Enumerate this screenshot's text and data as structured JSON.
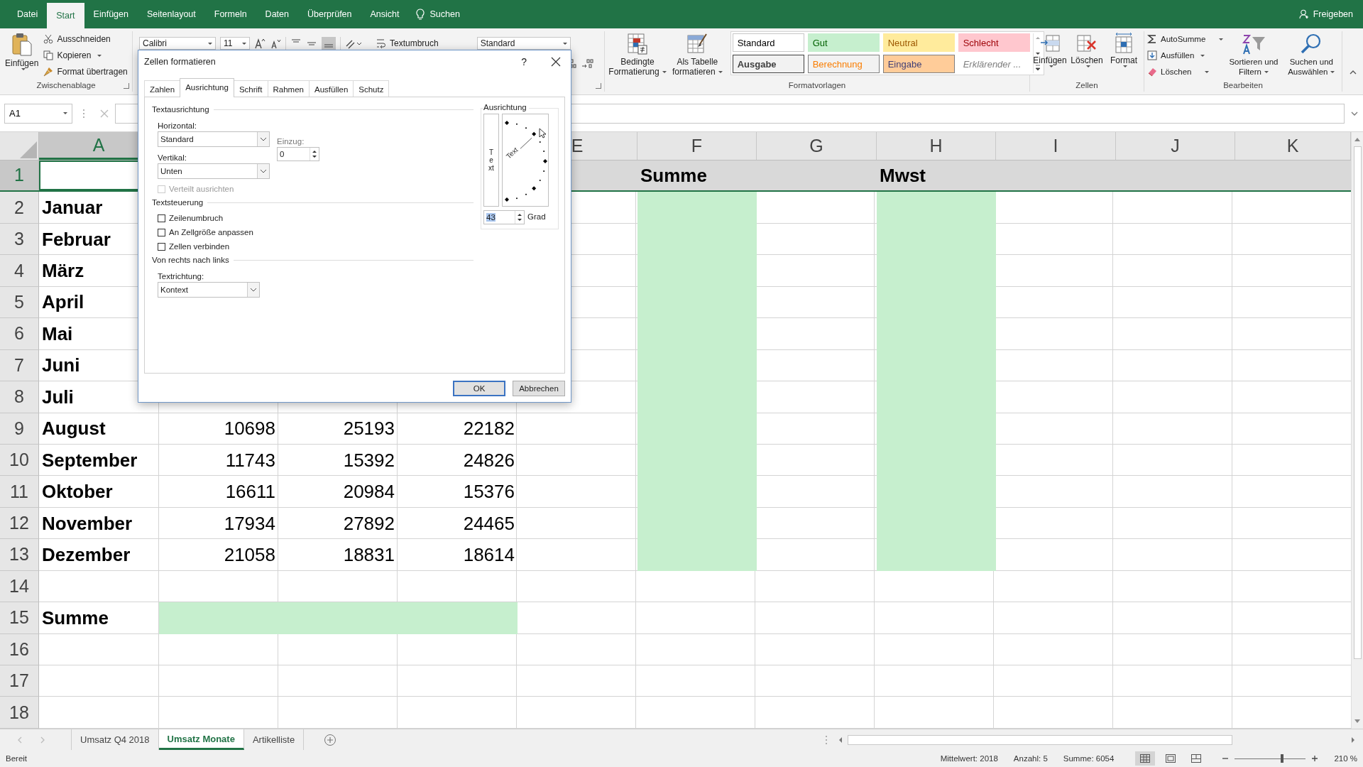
{
  "tabs": [
    {
      "label": "Datei",
      "selected": false
    },
    {
      "label": "Start",
      "selected": true
    },
    {
      "label": "Einfügen",
      "selected": false
    },
    {
      "label": "Seitenlayout",
      "selected": false
    },
    {
      "label": "Formeln",
      "selected": false
    },
    {
      "label": "Daten",
      "selected": false
    },
    {
      "label": "Überprüfen",
      "selected": false
    },
    {
      "label": "Ansicht",
      "selected": false
    }
  ],
  "search": {
    "placeholder": "Suchen"
  },
  "share": "Freigeben",
  "clipboard": {
    "paste": "Einfügen",
    "cut": "Ausschneiden",
    "copy": "Kopieren",
    "painter": "Format übertragen",
    "group": "Zwischenablage"
  },
  "font": {
    "family": "Calibri",
    "size": "11"
  },
  "wrap_text": "Textumbruch",
  "number_format": "Standard",
  "conditional_formatting": {
    "lines": [
      "Bedingte",
      "Formatierung"
    ]
  },
  "format_as_table": {
    "lines": [
      "Als Tabelle",
      "formatieren"
    ]
  },
  "styles": {
    "group": "Formatvorlagen",
    "items": [
      {
        "label": "Standard",
        "kind": "standard"
      },
      {
        "label": "Gut",
        "kind": "good"
      },
      {
        "label": "Neutral",
        "kind": "neutral"
      },
      {
        "label": "Schlecht",
        "kind": "bad"
      },
      {
        "label": "Ausgabe",
        "kind": "output"
      },
      {
        "label": "Berechnung",
        "kind": "calculation"
      },
      {
        "label": "Eingabe",
        "kind": "input"
      },
      {
        "label": "Erklärender ...",
        "kind": "explanatory"
      }
    ]
  },
  "cells_group": {
    "group": "Zellen",
    "buttons": [
      {
        "label": "Einfügen",
        "kind": "insert"
      },
      {
        "label": "Löschen",
        "kind": "delete"
      },
      {
        "label": "Format",
        "kind": "format"
      }
    ]
  },
  "editing": {
    "group": "Bearbeiten",
    "small": [
      {
        "label": "AutoSumme",
        "kind": "sum"
      },
      {
        "label": "Ausfüllen",
        "kind": "fill"
      },
      {
        "label": "Löschen",
        "kind": "clear"
      }
    ],
    "large": [
      {
        "lines": [
          "Sortieren und",
          "Filtern"
        ],
        "kind": "sort"
      },
      {
        "lines": [
          "Suchen und",
          "Auswählen"
        ],
        "kind": "find"
      }
    ]
  },
  "name_box": "A1",
  "columns": [
    {
      "label": "A",
      "selected": true
    },
    {},
    {},
    {},
    {
      "label": "E",
      "selected": false
    },
    {
      "label": "F",
      "selected": false
    },
    {
      "label": "G",
      "selected": false
    },
    {
      "label": "H",
      "selected": false
    },
    {
      "label": "I",
      "selected": false
    },
    {
      "label": "J",
      "selected": false
    },
    {
      "label": "K",
      "selected": false
    }
  ],
  "rows": [
    {
      "number": "1",
      "selected": true,
      "shaded": true,
      "cells": [
        {},
        {},
        {},
        {},
        {},
        {
          "text": "Summe",
          "kind": "label"
        },
        {},
        {
          "text": "Mwst",
          "kind": "label"
        },
        {},
        {},
        {}
      ]
    },
    {
      "number": "2",
      "selected": false,
      "shaded": false,
      "cells": [
        {
          "text": "Januar",
          "kind": "label"
        },
        {},
        {},
        {},
        {},
        {
          "highlighted": true
        },
        {},
        {
          "highlighted": true
        },
        {},
        {},
        {}
      ]
    },
    {
      "number": "3",
      "selected": false,
      "shaded": false,
      "cells": [
        {
          "text": "Februar",
          "kind": "label"
        },
        {},
        {},
        {},
        {},
        {
          "highlighted": true
        },
        {},
        {
          "highlighted": true
        },
        {},
        {},
        {}
      ]
    },
    {
      "number": "4",
      "selected": false,
      "shaded": false,
      "cells": [
        {
          "text": "März",
          "kind": "label"
        },
        {},
        {},
        {},
        {},
        {
          "highlighted": true
        },
        {},
        {
          "highlighted": true
        },
        {},
        {},
        {}
      ]
    },
    {
      "number": "5",
      "selected": false,
      "shaded": false,
      "cells": [
        {
          "text": "April",
          "kind": "label"
        },
        {},
        {},
        {},
        {},
        {
          "highlighted": true
        },
        {},
        {
          "highlighted": true
        },
        {},
        {},
        {}
      ]
    },
    {
      "number": "6",
      "selected": false,
      "shaded": false,
      "cells": [
        {
          "text": "Mai",
          "kind": "label"
        },
        {},
        {},
        {},
        {},
        {
          "highlighted": true
        },
        {},
        {
          "highlighted": true
        },
        {},
        {},
        {}
      ]
    },
    {
      "number": "7",
      "selected": false,
      "shaded": false,
      "cells": [
        {
          "text": "Juni",
          "kind": "label"
        },
        {},
        {},
        {},
        {},
        {
          "highlighted": true
        },
        {},
        {
          "highlighted": true
        },
        {},
        {},
        {}
      ]
    },
    {
      "number": "8",
      "selected": false,
      "shaded": false,
      "cells": [
        {
          "text": "Juli",
          "kind": "label"
        },
        {},
        {},
        {},
        {},
        {
          "highlighted": true
        },
        {},
        {
          "highlighted": true
        },
        {},
        {},
        {}
      ]
    },
    {
      "number": "9",
      "selected": false,
      "shaded": false,
      "cells": [
        {
          "text": "August",
          "kind": "label"
        },
        {
          "text": "10698",
          "kind": "number"
        },
        {
          "text": "25193",
          "kind": "number"
        },
        {
          "text": "22182",
          "kind": "number"
        },
        {},
        {
          "highlighted": true
        },
        {},
        {
          "highlighted": true
        },
        {},
        {},
        {}
      ]
    },
    {
      "number": "10",
      "selected": false,
      "shaded": false,
      "cells": [
        {
          "text": "September",
          "kind": "label"
        },
        {
          "text": "11743",
          "kind": "number"
        },
        {
          "text": "15392",
          "kind": "number"
        },
        {
          "text": "24826",
          "kind": "number"
        },
        {},
        {
          "highlighted": true
        },
        {},
        {
          "highlighted": true
        },
        {},
        {},
        {}
      ]
    },
    {
      "number": "11",
      "selected": false,
      "shaded": false,
      "cells": [
        {
          "text": "Oktober",
          "kind": "label"
        },
        {
          "text": "16611",
          "kind": "number"
        },
        {
          "text": "20984",
          "kind": "number"
        },
        {
          "text": "15376",
          "kind": "number"
        },
        {},
        {
          "highlighted": true
        },
        {},
        {
          "highlighted": true
        },
        {},
        {},
        {}
      ]
    },
    {
      "number": "12",
      "selected": false,
      "shaded": false,
      "cells": [
        {
          "text": "November",
          "kind": "label"
        },
        {
          "text": "17934",
          "kind": "number"
        },
        {
          "text": "27892",
          "kind": "number"
        },
        {
          "text": "24465",
          "kind": "number"
        },
        {},
        {
          "highlighted": true
        },
        {},
        {
          "highlighted": true
        },
        {},
        {},
        {}
      ]
    },
    {
      "number": "13",
      "selected": false,
      "shaded": false,
      "cells": [
        {
          "text": "Dezember",
          "kind": "label"
        },
        {
          "text": "21058",
          "kind": "number"
        },
        {
          "text": "18831",
          "kind": "number"
        },
        {
          "text": "18614",
          "kind": "number"
        },
        {},
        {
          "highlighted": true
        },
        {},
        {
          "highlighted": true
        },
        {},
        {},
        {}
      ]
    },
    {
      "number": "14",
      "selected": false,
      "shaded": false,
      "cells": [
        {},
        {},
        {},
        {},
        {},
        {},
        {},
        {},
        {},
        {},
        {}
      ]
    },
    {
      "number": "15",
      "selected": false,
      "shaded": false,
      "cells": [
        {
          "text": "Summe",
          "kind": "label"
        },
        {
          "highlighted": true
        },
        {
          "highlighted": true
        },
        {
          "highlighted": true
        },
        {},
        {},
        {},
        {},
        {},
        {},
        {}
      ]
    },
    {
      "number": "16",
      "selected": false,
      "shaded": false,
      "cells": [
        {},
        {},
        {},
        {},
        {},
        {},
        {},
        {},
        {},
        {},
        {}
      ]
    },
    {
      "number": "17",
      "selected": false,
      "shaded": false,
      "cells": [
        {},
        {},
        {},
        {},
        {},
        {},
        {},
        {},
        {},
        {},
        {}
      ]
    },
    {
      "number": "18",
      "selected": false,
      "shaded": false,
      "cells": [
        {},
        {},
        {},
        {},
        {},
        {},
        {},
        {},
        {},
        {},
        {}
      ]
    }
  ],
  "sheets": [
    {
      "label": "Umsatz Q4 2018",
      "selected": false
    },
    {
      "label": "Umsatz Monate",
      "selected": true
    },
    {
      "label": "Artikelliste",
      "selected": false
    }
  ],
  "status": {
    "mode": "Bereit",
    "average": "Mittelwert: 2018",
    "count": "Anzahl: 5",
    "sum": "Summe: 6054",
    "views": [
      {
        "kind": "normal",
        "selected": true
      },
      {
        "kind": "layout",
        "selected": false
      },
      {
        "kind": "pagebreak",
        "selected": false
      }
    ],
    "zoom": {
      "level": 0.67,
      "reading": "210 %"
    }
  },
  "dialog": {
    "title": "Zellen formatieren",
    "help": "?",
    "tabs": [
      {
        "label": "Zahlen",
        "selected": false
      },
      {
        "label": "Ausrichtung",
        "selected": true
      },
      {
        "label": "Schrift",
        "selected": false
      },
      {
        "label": "Rahmen",
        "selected": false
      },
      {
        "label": "Ausfüllen",
        "selected": false
      },
      {
        "label": "Schutz",
        "selected": false
      }
    ],
    "alignment_section": "Textausrichtung",
    "horizontal": {
      "label": "Horizontal:",
      "value": "Standard"
    },
    "indent": {
      "label": "Einzug:",
      "value": "0"
    },
    "vertical": {
      "label": "Vertikal:",
      "value": "Unten"
    },
    "distributed": {
      "label": "Verteilt ausrichten",
      "checked": false,
      "disabled": true
    },
    "control_section": "Textsteuerung",
    "text_control": [
      {
        "label": "Zeilenumbruch",
        "checked": false,
        "disabled": false
      },
      {
        "label": "An Zellgröße anpassen",
        "checked": false,
        "disabled": false
      },
      {
        "label": "Zellen verbinden",
        "checked": false,
        "disabled": false
      }
    ],
    "rtl_section": "Von rechts nach links",
    "direction": {
      "label": "Textrichtung:",
      "value": "Kontext"
    },
    "orientation": {
      "title": "Ausrichtung",
      "vertical_text": "Text",
      "dial_text": "Text",
      "degrees": "43",
      "unit": "Grad"
    },
    "buttons": [
      {
        "label": "OK",
        "kind": "default"
      },
      {
        "label": "Abbrechen",
        "kind": "normal"
      }
    ]
  }
}
